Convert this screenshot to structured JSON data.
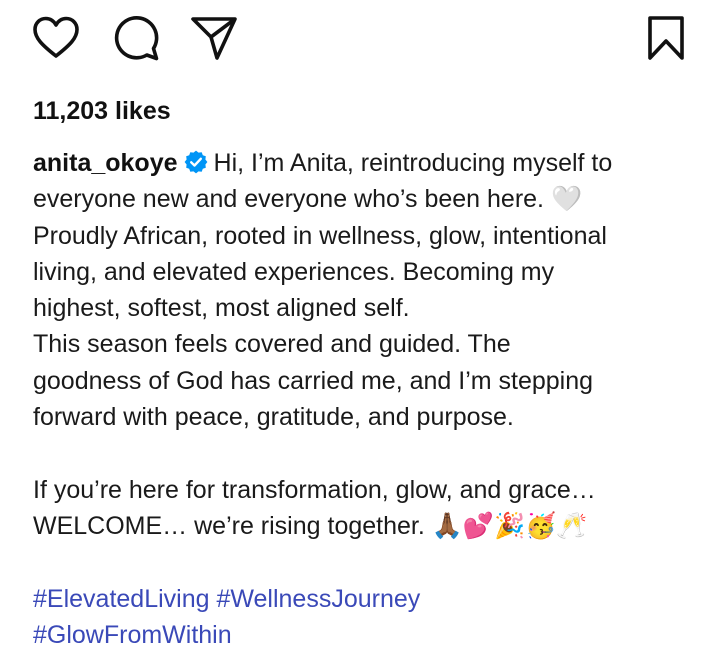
{
  "actions": {
    "like_icon": "heart-outline",
    "comment_icon": "speech-bubble",
    "share_icon": "paper-plane",
    "save_icon": "bookmark"
  },
  "likes": {
    "text": "11,203 likes"
  },
  "caption": {
    "username": "anita_okoye",
    "verified": true,
    "lines": [
      "Hi, I’m Anita, reintroducing myself to",
      "everyone new and everyone who’s been here. 🤍",
      "Proudly African, rooted in wellness, glow, intentional",
      "living, and elevated experiences. Becoming my",
      "highest, softest, most aligned self.",
      "This season feels covered and guided. The",
      "goodness of God has carried me, and I’m stepping",
      "forward with peace, gratitude, and purpose.",
      "",
      "If you’re here for transformation, glow, and grace…",
      "WELCOME… we’re rising together. 🙏🏾💕🎉🥳🥂"
    ],
    "hashtags": [
      "#ElevatedLiving",
      "#WellnessJourney",
      "#GlowFromWithin"
    ]
  },
  "colors": {
    "text": "#111111",
    "hashtag": "#3a49b8",
    "verified_badge": "#0095f6"
  }
}
